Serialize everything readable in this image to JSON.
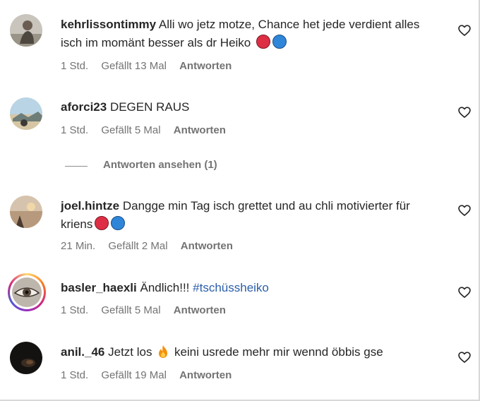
{
  "comments": [
    {
      "username": "kehrlissontimmy",
      "text": "Alli wo jetz motze, Chance het jede verdient alles isch im momänt besser als dr Heiko",
      "time": "1 Std.",
      "likes": "Gefällt 13 Mal",
      "reply": "Antworten",
      "avatar_icon": "person-photo"
    },
    {
      "username": "aforci23",
      "text": "DEGEN RAUS",
      "time": "1 Std.",
      "likes": "Gefällt 5 Mal",
      "reply": "Antworten",
      "avatar_icon": "beach-photo"
    },
    {
      "username": "joel.hintze",
      "text": "Dangge min Tag isch grettet und au chli motivierter für kriens",
      "time": "21 Min.",
      "likes": "Gefällt 2 Mal",
      "reply": "Antworten",
      "avatar_icon": "sunset-photo"
    },
    {
      "username": "basler_haexli",
      "text": "Ändlich!!!",
      "hashtag": "#tschüssheiko",
      "time": "1 Std.",
      "likes": "Gefällt 5 Mal",
      "reply": "Antworten",
      "avatar_icon": "eye-photo"
    },
    {
      "username": "anil._46",
      "text_before": "Jetzt los",
      "text_after": "keini usrede mehr mir wennd öbbis gse",
      "time": "1 Std.",
      "likes": "Gefällt 19 Mal",
      "reply": "Antworten",
      "avatar_icon": "dark-photo"
    }
  ],
  "view_replies": "Antworten ansehen (1)",
  "colors": {
    "username": "#262626",
    "meta": "#737373",
    "hashtag": "#2b5ea8",
    "ball_red": "#dd2e44",
    "ball_blue": "#2f86d9"
  }
}
